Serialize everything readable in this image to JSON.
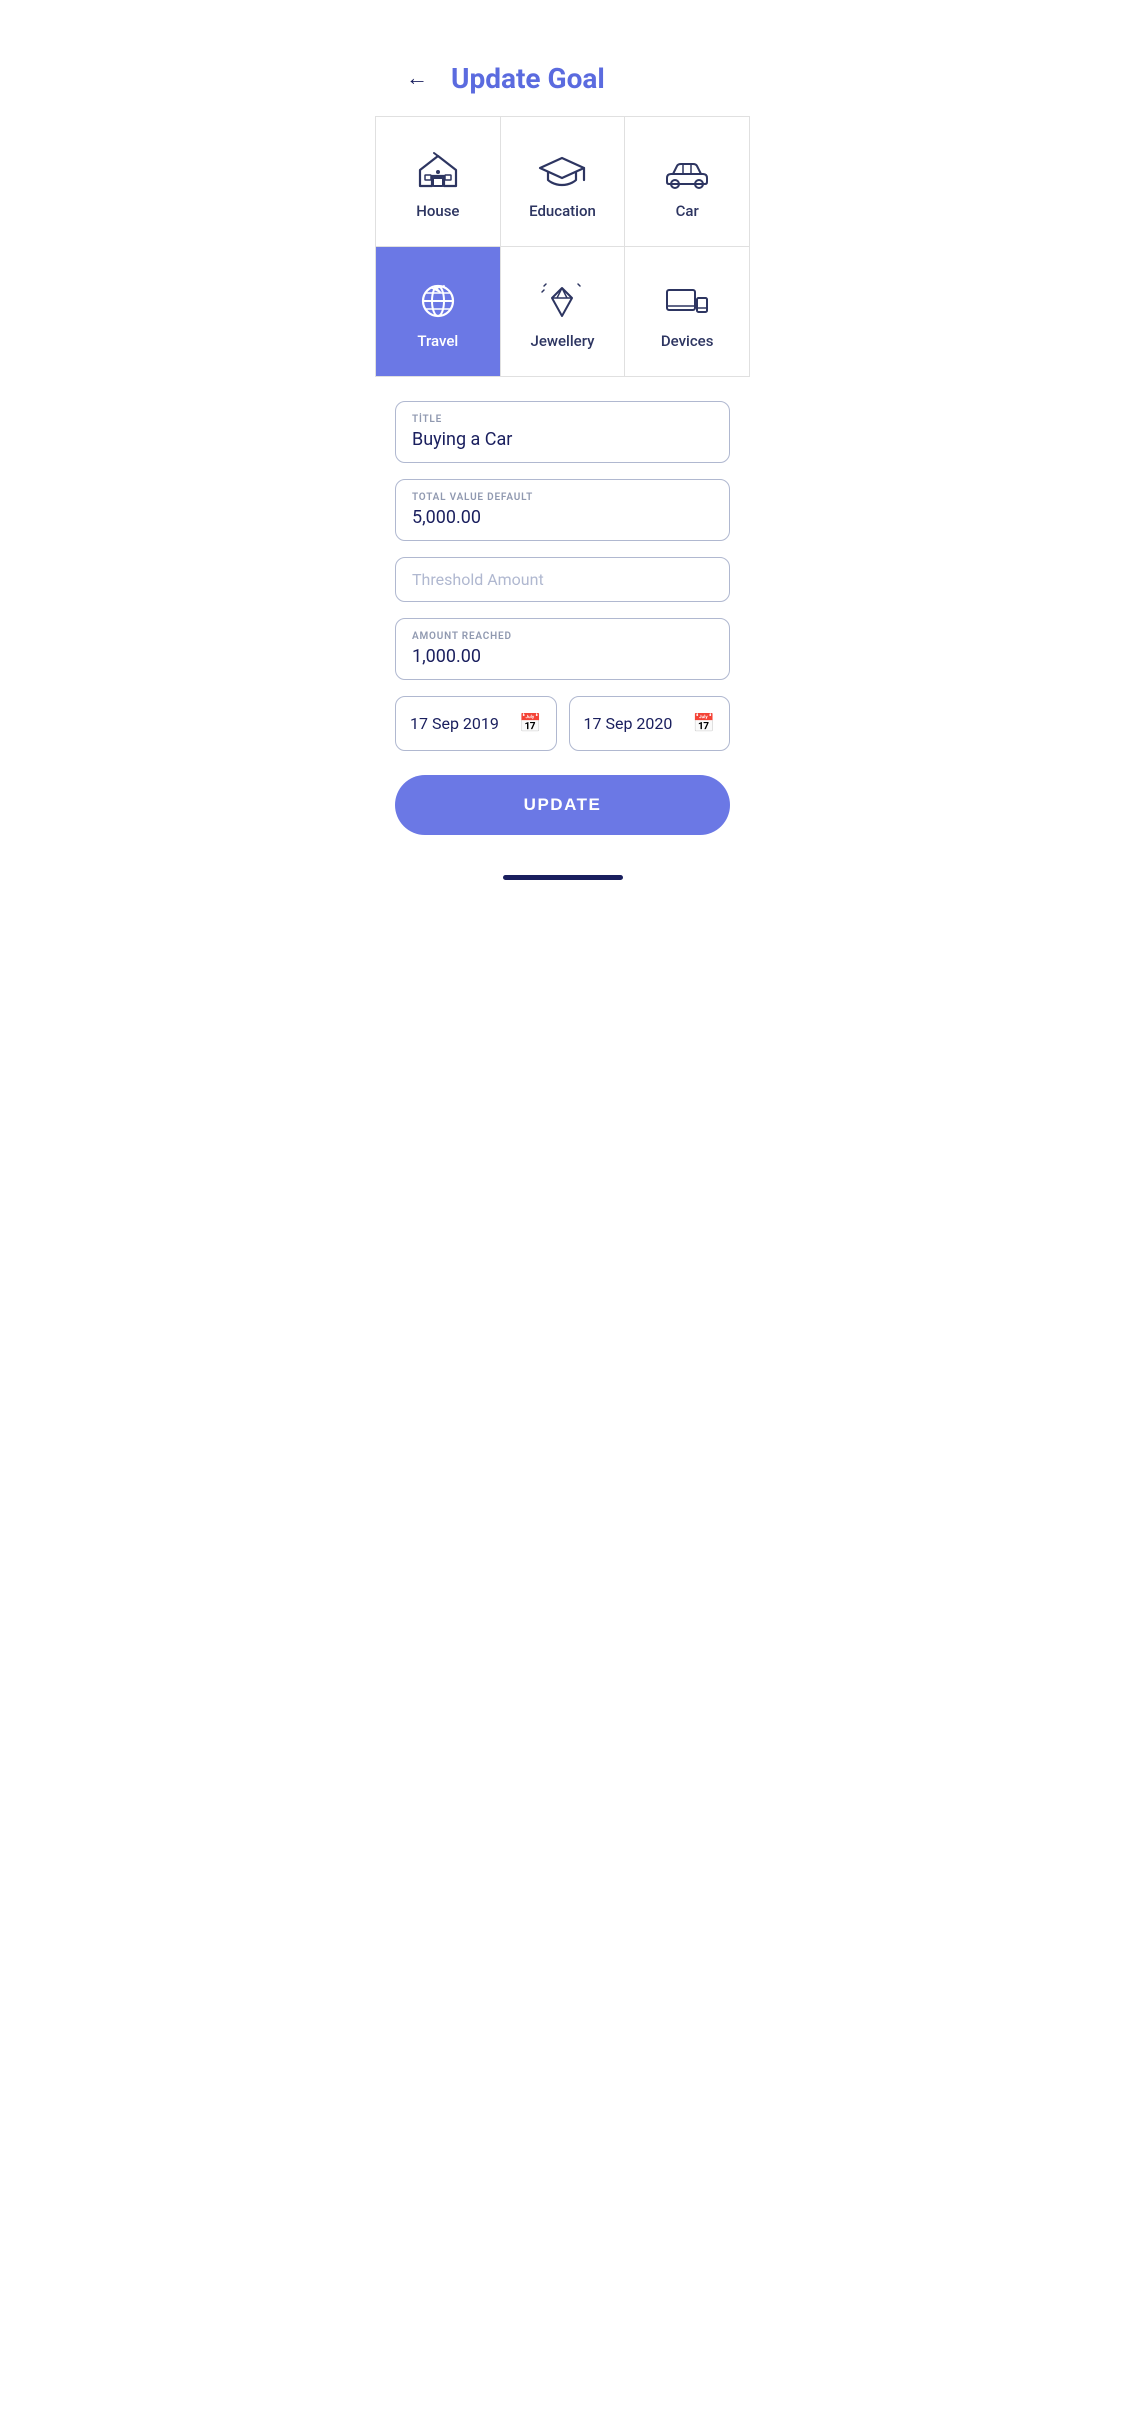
{
  "header": {
    "title": "Update Goal",
    "back_label": "←"
  },
  "categories": [
    {
      "id": "house",
      "label": "House",
      "active": false
    },
    {
      "id": "education",
      "label": "Education",
      "active": false
    },
    {
      "id": "car",
      "label": "Car",
      "active": false
    },
    {
      "id": "travel",
      "label": "Travel",
      "active": true
    },
    {
      "id": "jewellery",
      "label": "Jewellery",
      "active": false
    },
    {
      "id": "devices",
      "label": "Devices",
      "active": false
    }
  ],
  "form": {
    "title_label": "TİTLE",
    "title_value": "Buying a Car",
    "total_value_label": "TOTAL VALUE DEFAULT",
    "total_value": "5,000.00",
    "threshold_placeholder": "Threshold Amount",
    "amount_reached_label": "AMOUNT REACHED",
    "amount_reached": "1,000.00",
    "start_date": "17 Sep 2019",
    "end_date": "17 Sep 2020",
    "update_button": "UPDATE"
  },
  "colors": {
    "active_bg": "#6b78e5",
    "primary": "#1a1f5e",
    "accent": "#5b6bdf",
    "border": "#b0b8d0",
    "label": "#9099b0"
  }
}
